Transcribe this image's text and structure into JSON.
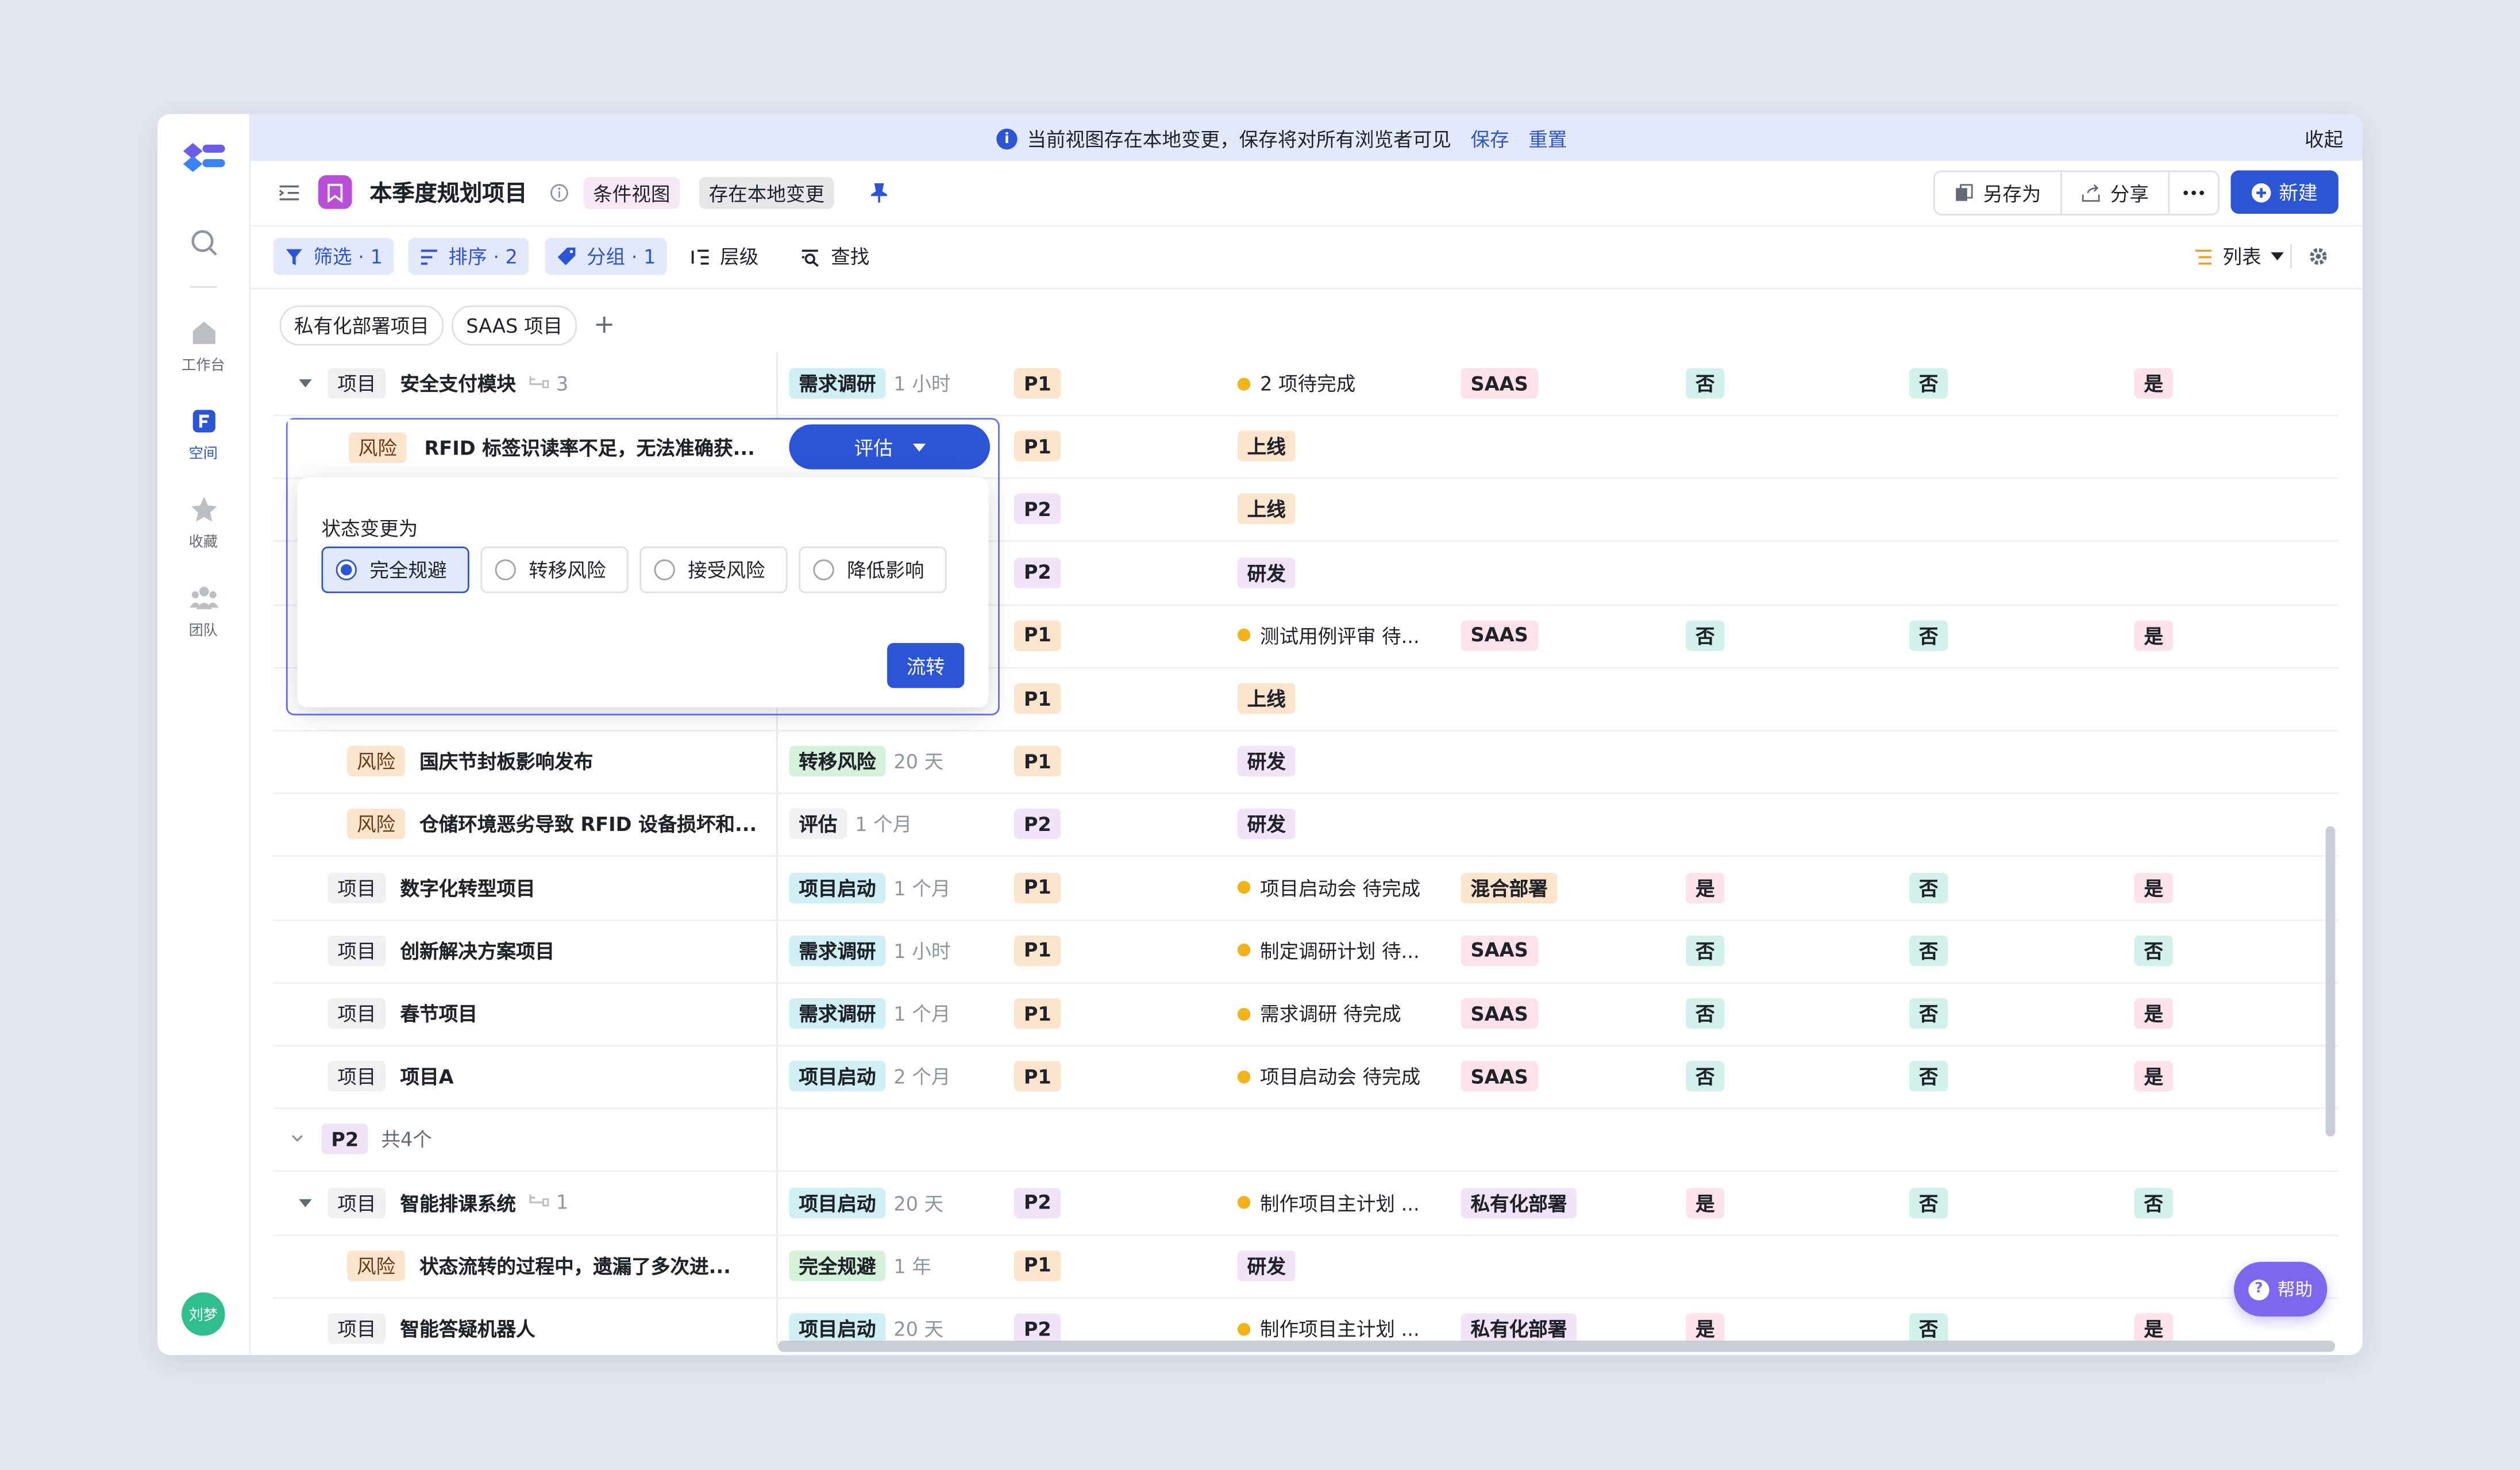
{
  "banner": {
    "message": "当前视图存在本地变更，保存将对所有浏览者可见",
    "save": "保存",
    "reset": "重置",
    "collapse": "收起"
  },
  "sidebar": {
    "items": [
      {
        "label": "工作台"
      },
      {
        "label": "空间"
      },
      {
        "label": "收藏"
      },
      {
        "label": "团队"
      }
    ],
    "user": "刘梦"
  },
  "header": {
    "title": "本季度规划项目",
    "view_type": "条件视图",
    "local_change": "存在本地变更",
    "save_as": "另存为",
    "share": "分享",
    "new": "新建"
  },
  "toolbar": {
    "filter": "筛选 · 1",
    "sort": "排序 · 2",
    "group": "分组 · 1",
    "level": "层级",
    "find": "查找",
    "view": "列表"
  },
  "tabs": [
    "私有化部署项目",
    "SAAS 项目"
  ],
  "rows": [
    {
      "indent": 1,
      "expand": true,
      "type": "项目",
      "name": "安全支付模块",
      "sub": "3",
      "status": "需求调研",
      "status_color": "cyan",
      "dur": "1 小时",
      "pri": "P1",
      "progress": "2 项待完成",
      "deploy": "SAAS",
      "deploy_color": "pink",
      "c1": "否",
      "c1c": "mint",
      "c2": "否",
      "c2c": "mint",
      "c3": "是",
      "c3c": "pink"
    },
    {
      "indent": 2,
      "type": "风险",
      "name": "RFID 标签识读率不足，无法准确获...",
      "status": "评估",
      "pri": "P1",
      "progress_tag": "上线"
    },
    {
      "indent": 2,
      "type": "风险",
      "name": "",
      "status": "",
      "pri": "P2",
      "progress_tag": "上线"
    },
    {
      "indent": 2,
      "type": "风险",
      "name": "",
      "status": "",
      "pri": "P2",
      "progress_tag": "研发"
    },
    {
      "indent": 1,
      "type": "项目",
      "name": "",
      "status": "",
      "pri": "P1",
      "progress": "测试用例评审 待...",
      "deploy": "SAAS",
      "deploy_color": "pink",
      "c1": "否",
      "c1c": "mint",
      "c2": "否",
      "c2c": "mint",
      "c3": "是",
      "c3c": "pink"
    },
    {
      "indent": 2,
      "type": "风险",
      "name": "",
      "status": "",
      "pri": "P1",
      "progress_tag": "上线"
    },
    {
      "indent": 2,
      "type": "风险",
      "name": "国庆节封板影响发布",
      "status": "转移风险",
      "status_color": "green",
      "dur": "20 天",
      "pri": "P1",
      "progress_tag": "研发"
    },
    {
      "indent": 2,
      "type": "风险",
      "name": "仓储环境恶劣导致 RFID 设备损坏和...",
      "status": "评估",
      "status_color": "grey",
      "dur": "1 个月",
      "pri": "P2",
      "progress_tag": "研发"
    },
    {
      "indent": 1,
      "type": "项目",
      "name": "数字化转型项目",
      "status": "项目启动",
      "status_color": "cyan",
      "dur": "1 个月",
      "pri": "P1",
      "progress": "项目启动会 待完成",
      "deploy": "混合部署",
      "deploy_color": "orange",
      "c1": "是",
      "c1c": "pink",
      "c2": "否",
      "c2c": "mint",
      "c3": "是",
      "c3c": "pink"
    },
    {
      "indent": 1,
      "type": "项目",
      "name": "创新解决方案项目",
      "status": "需求调研",
      "status_color": "cyan",
      "dur": "1 小时",
      "pri": "P1",
      "progress": "制定调研计划 待...",
      "deploy": "SAAS",
      "deploy_color": "pink",
      "c1": "否",
      "c1c": "mint",
      "c2": "否",
      "c2c": "mint",
      "c3": "否",
      "c3c": "mint"
    },
    {
      "indent": 1,
      "type": "项目",
      "name": "春节项目",
      "status": "需求调研",
      "status_color": "cyan",
      "dur": "1 个月",
      "pri": "P1",
      "progress": "需求调研 待完成",
      "deploy": "SAAS",
      "deploy_color": "pink",
      "c1": "否",
      "c1c": "mint",
      "c2": "否",
      "c2c": "mint",
      "c3": "是",
      "c3c": "pink"
    },
    {
      "indent": 1,
      "type": "项目",
      "name": "项目A",
      "status": "项目启动",
      "status_color": "cyan",
      "dur": "2 个月",
      "pri": "P1",
      "progress": "项目启动会 待完成",
      "deploy": "SAAS",
      "deploy_color": "pink",
      "c1": "否",
      "c1c": "mint",
      "c2": "否",
      "c2c": "mint",
      "c3": "是",
      "c3c": "pink"
    },
    {
      "group": true,
      "label": "P2",
      "count": "共4个"
    },
    {
      "indent": 1,
      "expand": true,
      "type": "项目",
      "name": "智能排课系统",
      "sub": "1",
      "status": "项目启动",
      "status_color": "cyan",
      "dur": "20 天",
      "pri": "P2",
      "progress": "制作项目主计划 ...",
      "deploy": "私有化部署",
      "deploy_color": "purple",
      "c1": "是",
      "c1c": "pink",
      "c2": "否",
      "c2c": "mint",
      "c3": "否",
      "c3c": "mint"
    },
    {
      "indent": 2,
      "type": "风险",
      "name": "状态流转的过程中，遗漏了多次进...",
      "status": "完全规避",
      "status_color": "green",
      "dur": "1 年",
      "pri": "P1",
      "progress_tag": "研发"
    },
    {
      "indent": 1,
      "type": "项目",
      "name": "智能答疑机器人",
      "status": "项目启动",
      "status_color": "cyan",
      "dur": "20 天",
      "pri": "P2",
      "progress": "制作项目主计划 ...",
      "deploy": "私有化部署",
      "deploy_color": "purple",
      "c1": "是",
      "c1c": "pink",
      "c2": "否",
      "c2c": "mint",
      "c3": "是",
      "c3c": "pink"
    }
  ],
  "popup": {
    "title": "状态变更为",
    "options": [
      "完全规避",
      "转移风险",
      "接受风险",
      "降低影响"
    ],
    "selected": "完全规避",
    "confirm": "流转",
    "current": "评估"
  },
  "help": "帮助",
  "colors": {
    "accent": "#2c54d6",
    "help": "#7b68ee"
  }
}
